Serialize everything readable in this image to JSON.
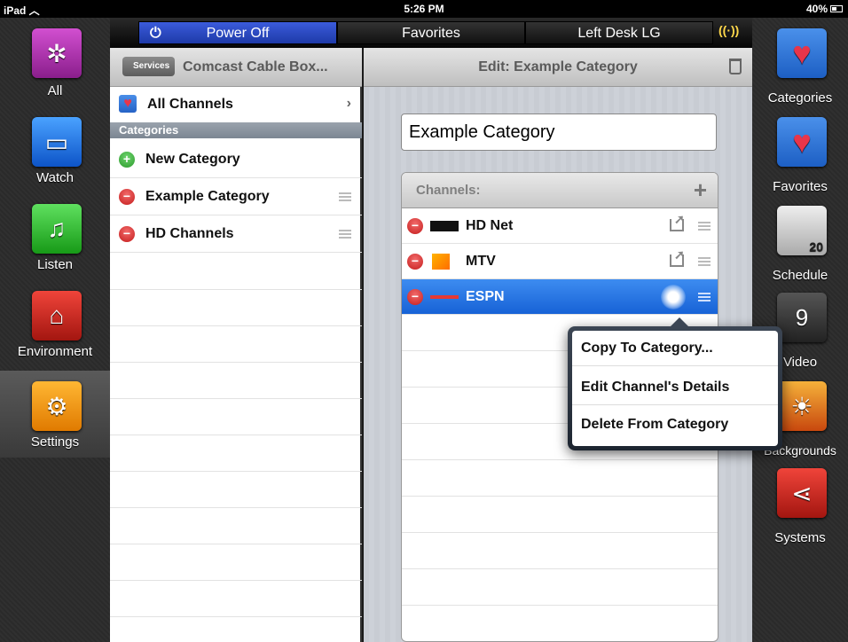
{
  "status_bar": {
    "device": "iPad",
    "time": "5:26 PM",
    "battery": "40%"
  },
  "top_bar": {
    "power": "Power Off",
    "favorites": "Favorites",
    "room": "Left Desk LG"
  },
  "left_rail": [
    {
      "label": "All",
      "icon": "compass-icon"
    },
    {
      "label": "Watch",
      "icon": "tv-icon"
    },
    {
      "label": "Listen",
      "icon": "music-note-icon"
    },
    {
      "label": "Environment",
      "icon": "house-bulb-icon"
    },
    {
      "label": "Settings",
      "icon": "gears-icon"
    }
  ],
  "right_rail": [
    {
      "label": "Categories",
      "icon": "heart-icon"
    },
    {
      "label": "Favorites",
      "icon": "heart-plus-icon"
    },
    {
      "label": "Schedule",
      "icon": "thermometer-calendar-icon"
    },
    {
      "label": "Video",
      "icon": "film-countdown-icon"
    },
    {
      "label": "Backgrounds",
      "icon": "sunset-icon"
    },
    {
      "label": "Systems",
      "icon": "share-nodes-icon"
    }
  ],
  "calendar_day": "20",
  "video_number": "9",
  "left_pane": {
    "back_label": "Services",
    "title": "Comcast Cable Box...",
    "all_channels": "All Channels",
    "section": "Categories",
    "new_category": "New Category",
    "categories": [
      "Example Category",
      "HD Channels"
    ]
  },
  "right_pane": {
    "title": "Edit: Example Category",
    "name_value": "Example Category",
    "channels_header": "Channels:",
    "channels": [
      {
        "name": "HD Net",
        "logo": "hdnet-logo"
      },
      {
        "name": "MTV",
        "logo": "mtv-logo"
      },
      {
        "name": "ESPN",
        "logo": "espn-logo"
      }
    ]
  },
  "popover": {
    "items": [
      "Copy To Category...",
      "Edit Channel's Details",
      "Delete From Category"
    ]
  }
}
